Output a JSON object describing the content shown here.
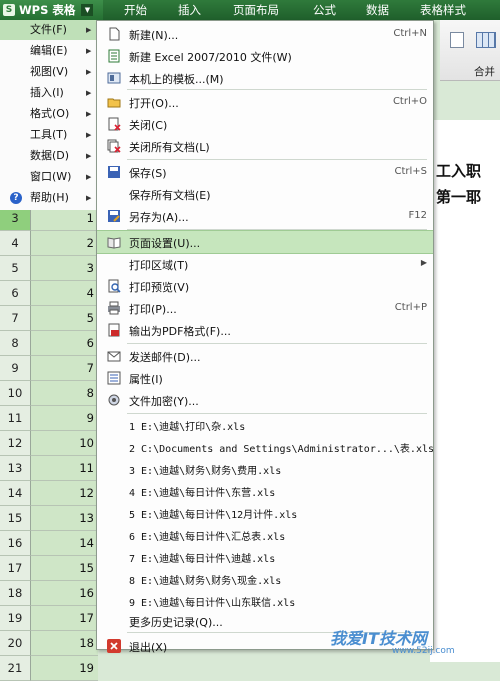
{
  "app": {
    "title": "WPS 表格"
  },
  "menu_tabs": [
    "开始",
    "插入",
    "页面布局",
    "公式",
    "数据",
    "表格样式"
  ],
  "toolbar": {
    "merge_label": "合并"
  },
  "main_menu": [
    {
      "label": "文件(F)",
      "active": true
    },
    {
      "label": "编辑(E)"
    },
    {
      "label": "视图(V)"
    },
    {
      "label": "插入(I)"
    },
    {
      "label": "格式(O)"
    },
    {
      "label": "工具(T)"
    },
    {
      "label": "数据(D)"
    },
    {
      "label": "窗口(W)"
    },
    {
      "label": "帮助(H)"
    }
  ],
  "file_menu": [
    {
      "label": "新建(N)...",
      "shortcut": "Ctrl+N",
      "icon": "new-document-icon"
    },
    {
      "label": "新建 Excel 2007/2010 文件(W)",
      "icon": "new-excel-icon"
    },
    {
      "label": "本机上的模板...(M)",
      "icon": "template-icon"
    },
    {
      "label": "打开(O)...",
      "shortcut": "Ctrl+O",
      "icon": "open-folder-icon"
    },
    {
      "label": "关闭(C)",
      "icon": "close-document-icon"
    },
    {
      "label": "关闭所有文档(L)",
      "icon": "close-all-icon"
    },
    {
      "label": "保存(S)",
      "shortcut": "Ctrl+S",
      "icon": "save-icon"
    },
    {
      "label": "保存所有文档(E)"
    },
    {
      "label": "另存为(A)...",
      "shortcut": "F12",
      "icon": "save-as-icon"
    },
    {
      "label": "页面设置(U)...",
      "icon": "page-setup-icon",
      "highlighted": true
    },
    {
      "label": "打印区域(T)",
      "submenu": true
    },
    {
      "label": "打印预览(V)",
      "icon": "print-preview-icon"
    },
    {
      "label": "打印(P)...",
      "shortcut": "Ctrl+P",
      "icon": "print-icon"
    },
    {
      "label": "输出为PDF格式(F)...",
      "icon": "pdf-export-icon"
    },
    {
      "label": "发送邮件(D)...",
      "icon": "mail-icon"
    },
    {
      "label": "属性(I)",
      "icon": "properties-icon"
    },
    {
      "label": "文件加密(Y)...",
      "icon": "encrypt-icon"
    },
    {
      "label": "1 E:\\迪越\\打印\\杂.xls"
    },
    {
      "label": "2 C:\\Documents and Settings\\Administrator...\\表.xls"
    },
    {
      "label": "3 E:\\迪越\\财务\\财务\\费用.xls"
    },
    {
      "label": "4 E:\\迪越\\每日计件\\东营.xls"
    },
    {
      "label": "5 E:\\迪越\\每日计件\\12月计件.xls"
    },
    {
      "label": "6 E:\\迪越\\每日计件\\汇总表.xls"
    },
    {
      "label": "7 E:\\迪越\\每日计件\\迪越.xls"
    },
    {
      "label": "8 E:\\迪越\\财务\\财务\\现金.xls"
    },
    {
      "label": "9 E:\\迪越\\每日计件\\山东联信.xls"
    },
    {
      "label": "更多历史记录(Q)..."
    },
    {
      "label": "退出(X)",
      "icon": "exit-icon"
    }
  ],
  "sheet": {
    "rows": [
      {
        "num": "3",
        "a": "1"
      },
      {
        "num": "4",
        "a": "2"
      },
      {
        "num": "5",
        "a": "3"
      },
      {
        "num": "6",
        "a": "4"
      },
      {
        "num": "7",
        "a": "5"
      },
      {
        "num": "8",
        "a": "6"
      },
      {
        "num": "9",
        "a": "7"
      },
      {
        "num": "10",
        "a": "8"
      },
      {
        "num": "11",
        "a": "9"
      },
      {
        "num": "12",
        "a": "10"
      },
      {
        "num": "13",
        "a": "11"
      },
      {
        "num": "14",
        "a": "12"
      },
      {
        "num": "15",
        "a": "13"
      },
      {
        "num": "16",
        "a": "14"
      },
      {
        "num": "17",
        "a": "15"
      },
      {
        "num": "18",
        "a": "16"
      },
      {
        "num": "19",
        "a": "17"
      },
      {
        "num": "20",
        "a": "18"
      },
      {
        "num": "21",
        "a": "19"
      }
    ],
    "title_line1": "工入职",
    "title_line2": "第一耶"
  },
  "watermark": {
    "main": "我爱IT技术网",
    "sub": "www.52ij.com"
  }
}
